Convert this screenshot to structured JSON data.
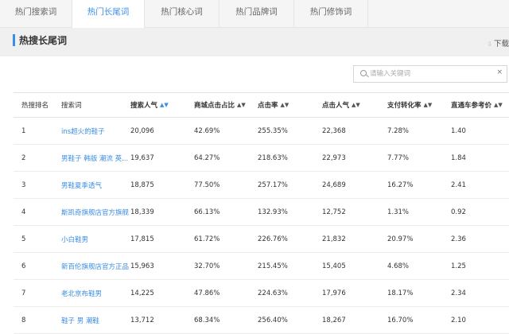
{
  "tabs": [
    {
      "label": "热门搜索词",
      "active": false
    },
    {
      "label": "热门长尾词",
      "active": true
    },
    {
      "label": "热门核心词",
      "active": false
    },
    {
      "label": "热门品牌词",
      "active": false
    },
    {
      "label": "热门修饰词",
      "active": false
    }
  ],
  "section": {
    "title": "热搜长尾词",
    "download_label": "下载"
  },
  "search": {
    "placeholder": "请输入关键词",
    "clear": "×"
  },
  "table": {
    "headers": [
      "热搜排名",
      "搜索词",
      "搜索人气",
      "商城点击占比",
      "点击率",
      "点击人气",
      "支付转化率",
      "直通车参考价"
    ],
    "rows": [
      {
        "rank": "1",
        "keyword": "ins超火的鞋子",
        "search_popularity": "20,096",
        "mall_click_share": "42.69%",
        "ctr": "255.35%",
        "click_popularity": "22,368",
        "pay_conversion": "7.28%",
        "ztc_price": "1.40"
      },
      {
        "rank": "2",
        "keyword": "男鞋子 韩版 潮流 英...",
        "search_popularity": "19,637",
        "mall_click_share": "64.27%",
        "ctr": "218.63%",
        "click_popularity": "22,973",
        "pay_conversion": "7.77%",
        "ztc_price": "1.84"
      },
      {
        "rank": "3",
        "keyword": "男鞋夏季透气",
        "search_popularity": "18,875",
        "mall_click_share": "77.50%",
        "ctr": "257.17%",
        "click_popularity": "24,689",
        "pay_conversion": "16.27%",
        "ztc_price": "2.41"
      },
      {
        "rank": "4",
        "keyword": "斯凯奇旗舰店官方旗舰",
        "search_popularity": "18,339",
        "mall_click_share": "66.13%",
        "ctr": "132.93%",
        "click_popularity": "12,752",
        "pay_conversion": "1.31%",
        "ztc_price": "0.92"
      },
      {
        "rank": "5",
        "keyword": "小白鞋男",
        "search_popularity": "17,815",
        "mall_click_share": "61.72%",
        "ctr": "226.76%",
        "click_popularity": "21,832",
        "pay_conversion": "20.97%",
        "ztc_price": "2.36"
      },
      {
        "rank": "6",
        "keyword": "新百伦旗舰店官方正品",
        "search_popularity": "15,963",
        "mall_click_share": "32.70%",
        "ctr": "215.45%",
        "click_popularity": "15,405",
        "pay_conversion": "4.68%",
        "ztc_price": "1.25"
      },
      {
        "rank": "7",
        "keyword": "老北京布鞋男",
        "search_popularity": "14,225",
        "mall_click_share": "47.86%",
        "ctr": "224.63%",
        "click_popularity": "17,976",
        "pay_conversion": "18.17%",
        "ztc_price": "2.34"
      },
      {
        "rank": "8",
        "keyword": "鞋子 男 潮鞋",
        "search_popularity": "13,712",
        "mall_click_share": "68.34%",
        "ctr": "256.40%",
        "click_popularity": "18,267",
        "pay_conversion": "16.70%",
        "ztc_price": "2.10"
      }
    ]
  },
  "icons": {
    "download": "download-icon",
    "search": "search-icon",
    "sort": "sort-icon"
  },
  "colors": {
    "accent": "#3a8ee6",
    "tab_bar_bg": "#f5f5f5",
    "section_bg": "#f0f0f0",
    "row_border": "#ececec"
  }
}
